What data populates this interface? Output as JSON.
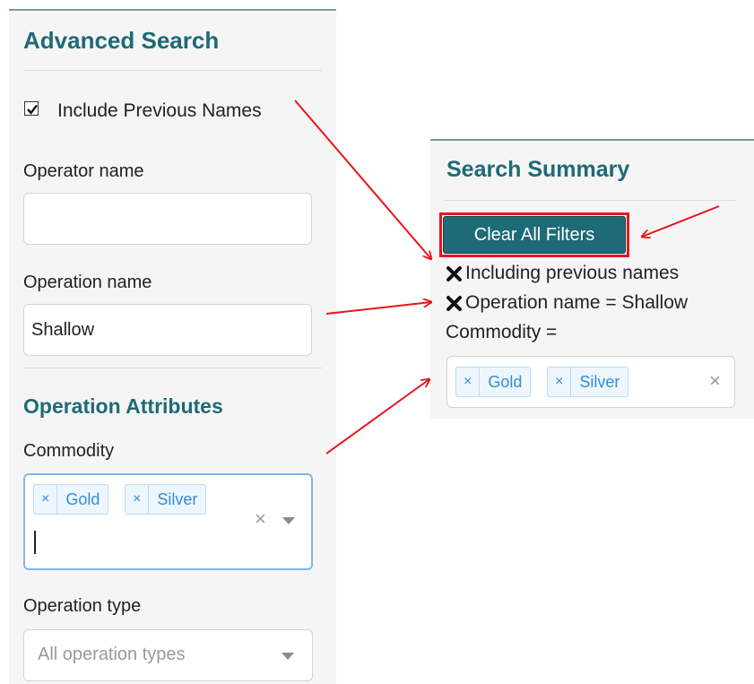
{
  "advanced_search": {
    "title": "Advanced Search",
    "include_previous_names": {
      "label": "Include Previous Names",
      "checked": true
    },
    "operator_name": {
      "label": "Operator name",
      "value": ""
    },
    "operation_name": {
      "label": "Operation name",
      "value": "Shallow"
    },
    "operation_attributes": {
      "title": "Operation Attributes",
      "commodity": {
        "label": "Commodity",
        "tags": [
          "Gold",
          "Silver"
        ],
        "remove_glyph": "×",
        "clear_glyph": "×"
      },
      "operation_type": {
        "label": "Operation type",
        "placeholder": "All operation types"
      }
    }
  },
  "search_summary": {
    "title": "Search Summary",
    "clear_all_button": "Clear All Filters",
    "filters": [
      {
        "text": "Including previous names",
        "removable": true
      },
      {
        "text": "Operation name = Shallow",
        "removable": true
      },
      {
        "text": "Commodity =",
        "removable": false
      }
    ],
    "commodity_tags": [
      "Gold",
      "Silver"
    ],
    "clear_glyph": "×"
  },
  "colors": {
    "heading": "#1e6a76",
    "button_bg": "#1e6a76",
    "highlight": "#e8141c",
    "tag_text": "#2f8ed8",
    "tag_bg": "#eef6fd",
    "focus_border": "#7fb6e8"
  },
  "icons": [
    "checkmark-icon",
    "remove-filter-x-icon",
    "tag-remove-icon",
    "clear-selection-icon",
    "dropdown-arrow-icon",
    "annotation-arrow"
  ]
}
